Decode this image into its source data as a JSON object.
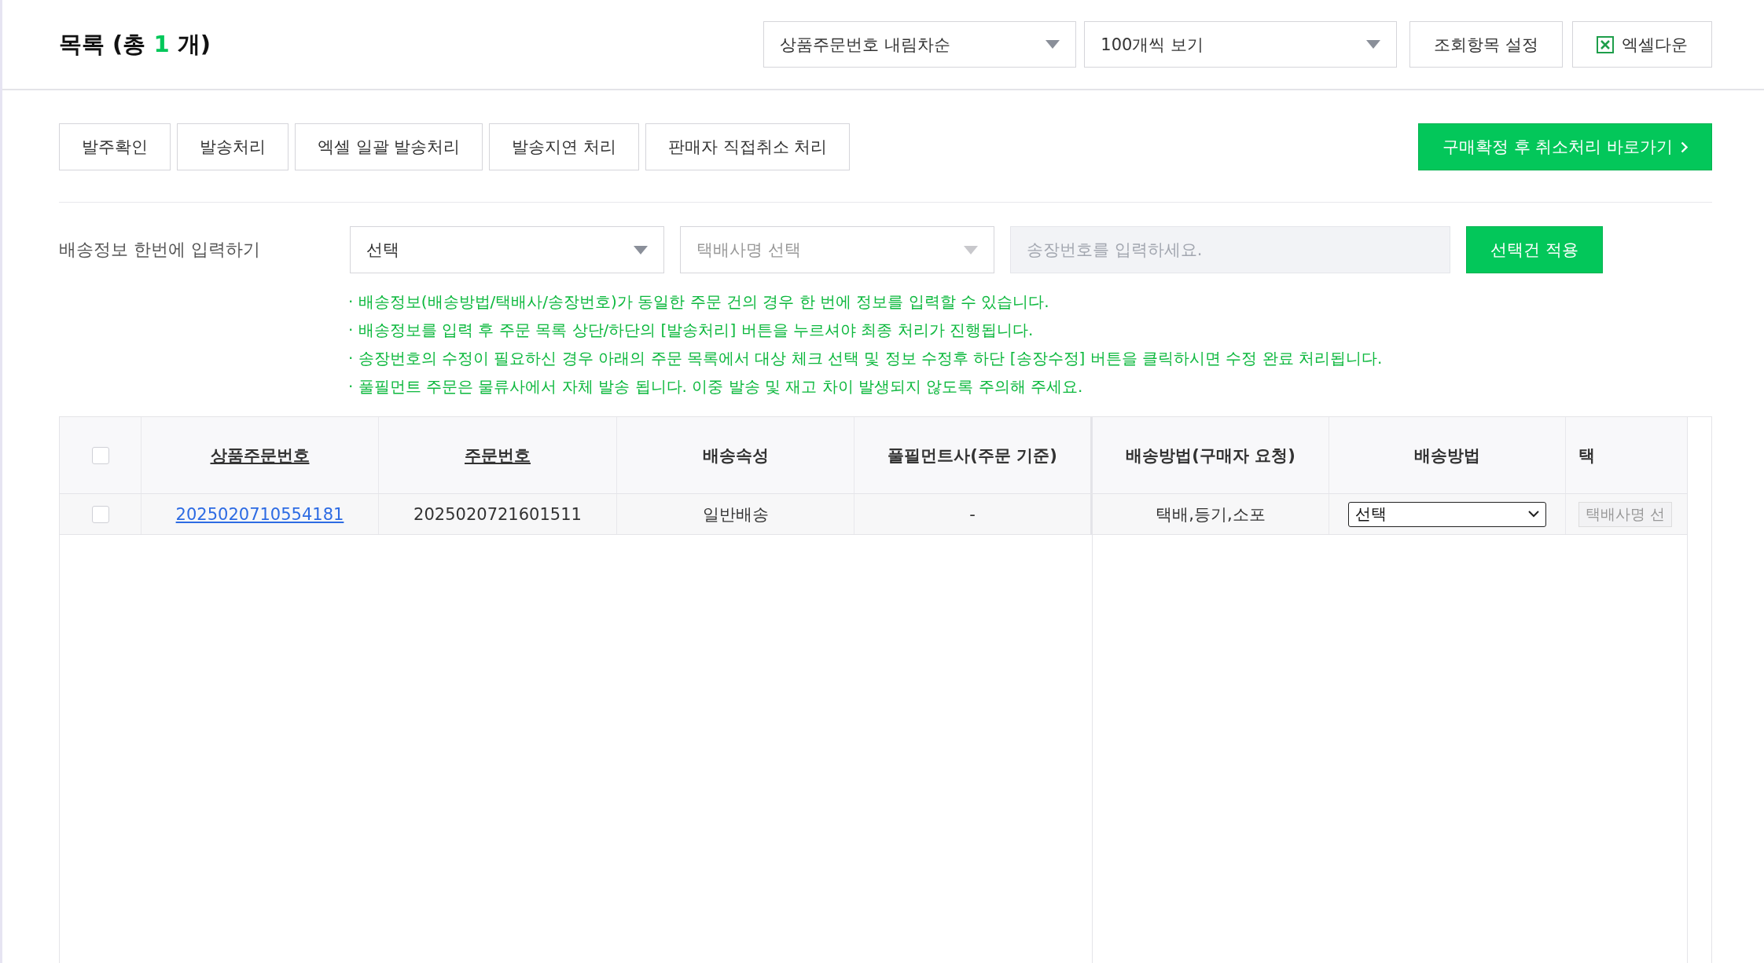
{
  "header": {
    "title": "목록 (총",
    "count": "1",
    "unit": "개)",
    "dropdowns": [
      {
        "value": "상품주문번호 내림차순"
      },
      {
        "value": "100개씩 보기"
      }
    ],
    "buttons": [
      {
        "label": "조회항목 설정",
        "kind": "plain"
      },
      {
        "label": "엑셀다운",
        "kind": "excel"
      }
    ]
  },
  "actions": {
    "buttons": [
      "발주확인",
      "발송처리",
      "엑셀 일괄 발송처리",
      "발송지연 처리",
      "판매자 직접취소 처리"
    ],
    "primary_link": "구매확정 후 취소처리 바로가기"
  },
  "bulk_shipping": {
    "label": "배송정보 한번에 입력하기",
    "selects": [
      {
        "value": "선택",
        "disabled": false
      },
      {
        "value": "택배사명 선택",
        "disabled": true
      }
    ],
    "tracking": {
      "placeholder": "송장번호를 입력하세요."
    },
    "apply_button": "선택건 적용",
    "notices": [
      "· 배송정보(배송방법/택배사/송장번호)가 동일한 주문 건의 경우 한 번에 정보를 입력할 수 있습니다.",
      "· 배송정보를 입력 후 주문 목록 상단/하단의 [발송처리] 버튼을 누르셔야 최종 처리가 진행됩니다.",
      "· 송장번호의 수정이 필요하신 경우 아래의 주문 목록에서 대상 체크 선택 및 정보 수정후 하단 [송장수정] 버튼을 클릭하시면 수정 완료 처리됩니다.",
      "· 풀필먼트 주문은 물류사에서 자체 발송 됩니다. 이중 발송 및 재고 차이 발생되지 않도록 주의해 주세요."
    ]
  },
  "table": {
    "header_checkbox": {
      "checked": false
    },
    "columns": [
      {
        "label": "상품주문번호",
        "sortable": true
      },
      {
        "label": "주문번호",
        "sortable": true
      },
      {
        "label": "배송속성",
        "sortable": false
      },
      {
        "label": "풀필먼트사(주문 기준)",
        "sortable": false
      },
      {
        "label": "배송방법(구매자 요청)",
        "sortable": false
      },
      {
        "label": "배송방법",
        "sortable": false
      },
      {
        "label": "택",
        "sortable": false
      }
    ],
    "rows": [
      {
        "checked": false,
        "cells": [
          {
            "kind": "link",
            "text": "2025020710554181"
          },
          {
            "kind": "text",
            "text": "2025020721601511"
          },
          {
            "kind": "text",
            "text": "일반배송"
          },
          {
            "kind": "text",
            "text": "-"
          },
          {
            "kind": "text",
            "text": "택배,등기,소포"
          },
          {
            "kind": "select",
            "text": "선택"
          },
          {
            "kind": "field",
            "text": "택배사명 선"
          }
        ]
      }
    ]
  }
}
